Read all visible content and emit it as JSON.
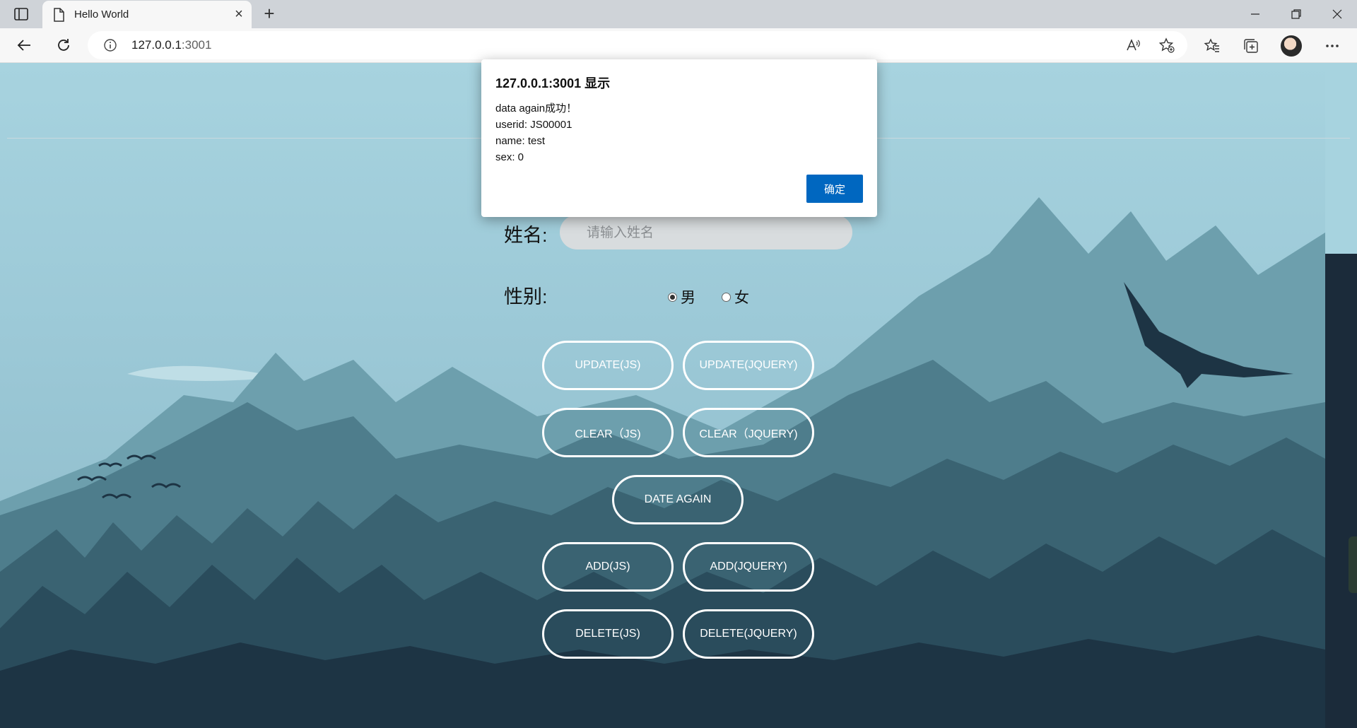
{
  "browser": {
    "tab_title": "Hello World",
    "url_host": "127.0.0.1",
    "url_port": ":3001"
  },
  "form": {
    "name_label": "姓名:",
    "name_placeholder": "请输入姓名",
    "sex_label": "性别:",
    "radio_male": "男",
    "radio_female": "女",
    "selected_sex": "男"
  },
  "buttons": {
    "update_js": "UPDATE(JS)",
    "update_jquery": "UPDATE(JQUERY)",
    "clear_js": "CLEAR（JS)",
    "clear_jquery": "CLEAR（JQUERY)",
    "date_again": "DATE AGAIN",
    "add_js": "ADD(JS)",
    "add_jquery": "ADD(JQUERY)",
    "delete_js": "DELETE(JS)",
    "delete_jquery": "DELETE(JQUERY)"
  },
  "dialog": {
    "title": "127.0.0.1:3001 显示",
    "lines": [
      "data again成功！",
      "userid: JS00001",
      "name: test",
      "sex: 0"
    ],
    "ok_label": "确定"
  },
  "colors": {
    "sky": "#a7d3df",
    "dialog_button": "#0067c0",
    "button_border": "#ffffff"
  }
}
